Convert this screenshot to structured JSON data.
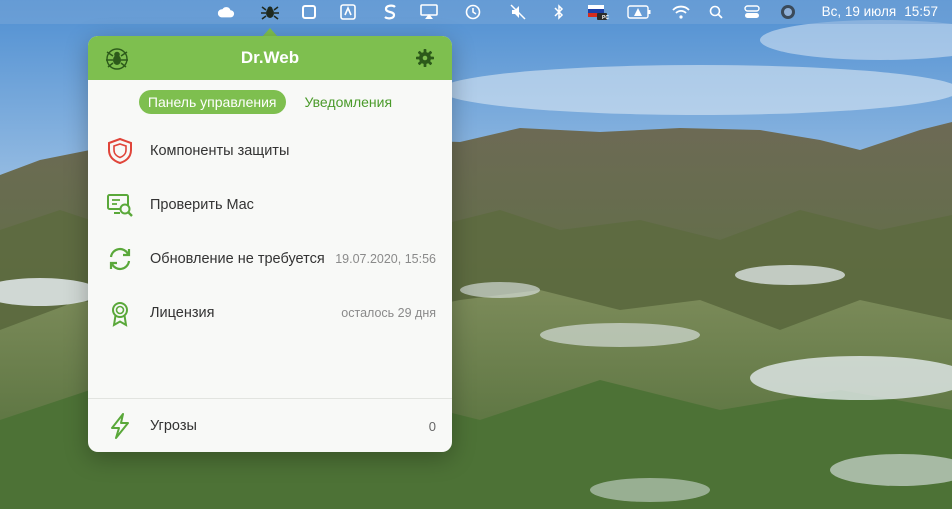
{
  "menubar": {
    "date": "Вс, 19 июля",
    "time": "15:57",
    "icons": [
      "cloud-icon",
      "drweb-spider-icon",
      "square-icon",
      "app-icon",
      "s-icon",
      "airplay-icon",
      "time-machine-icon",
      "mute-icon",
      "bluetooth-icon",
      "flag-ru-icon",
      "battery-warning-icon",
      "wifi-icon",
      "search-icon",
      "control-center-icon",
      "siri-icon"
    ],
    "flag_badge": "PC"
  },
  "popover": {
    "title": "Dr.Web",
    "tabs": [
      {
        "label": "Панель управления",
        "active": true
      },
      {
        "label": "Уведомления",
        "active": false
      }
    ],
    "items": [
      {
        "icon": "shield-icon",
        "label": "Компоненты защиты",
        "value": ""
      },
      {
        "icon": "scan-mac-icon",
        "label": "Проверить Mac",
        "value": ""
      },
      {
        "icon": "update-icon",
        "label": "Обновление не требуется",
        "value": "19.07.2020, 15:56"
      },
      {
        "icon": "license-icon",
        "label": "Лицензия",
        "value": "осталось 29 дня"
      }
    ],
    "threats": {
      "icon": "lightning-icon",
      "label": "Угрозы",
      "value": "0"
    }
  },
  "colors": {
    "brand_green": "#7ebf4f",
    "tab_text_green": "#4a9a2a",
    "shield_red": "#e0453a"
  }
}
